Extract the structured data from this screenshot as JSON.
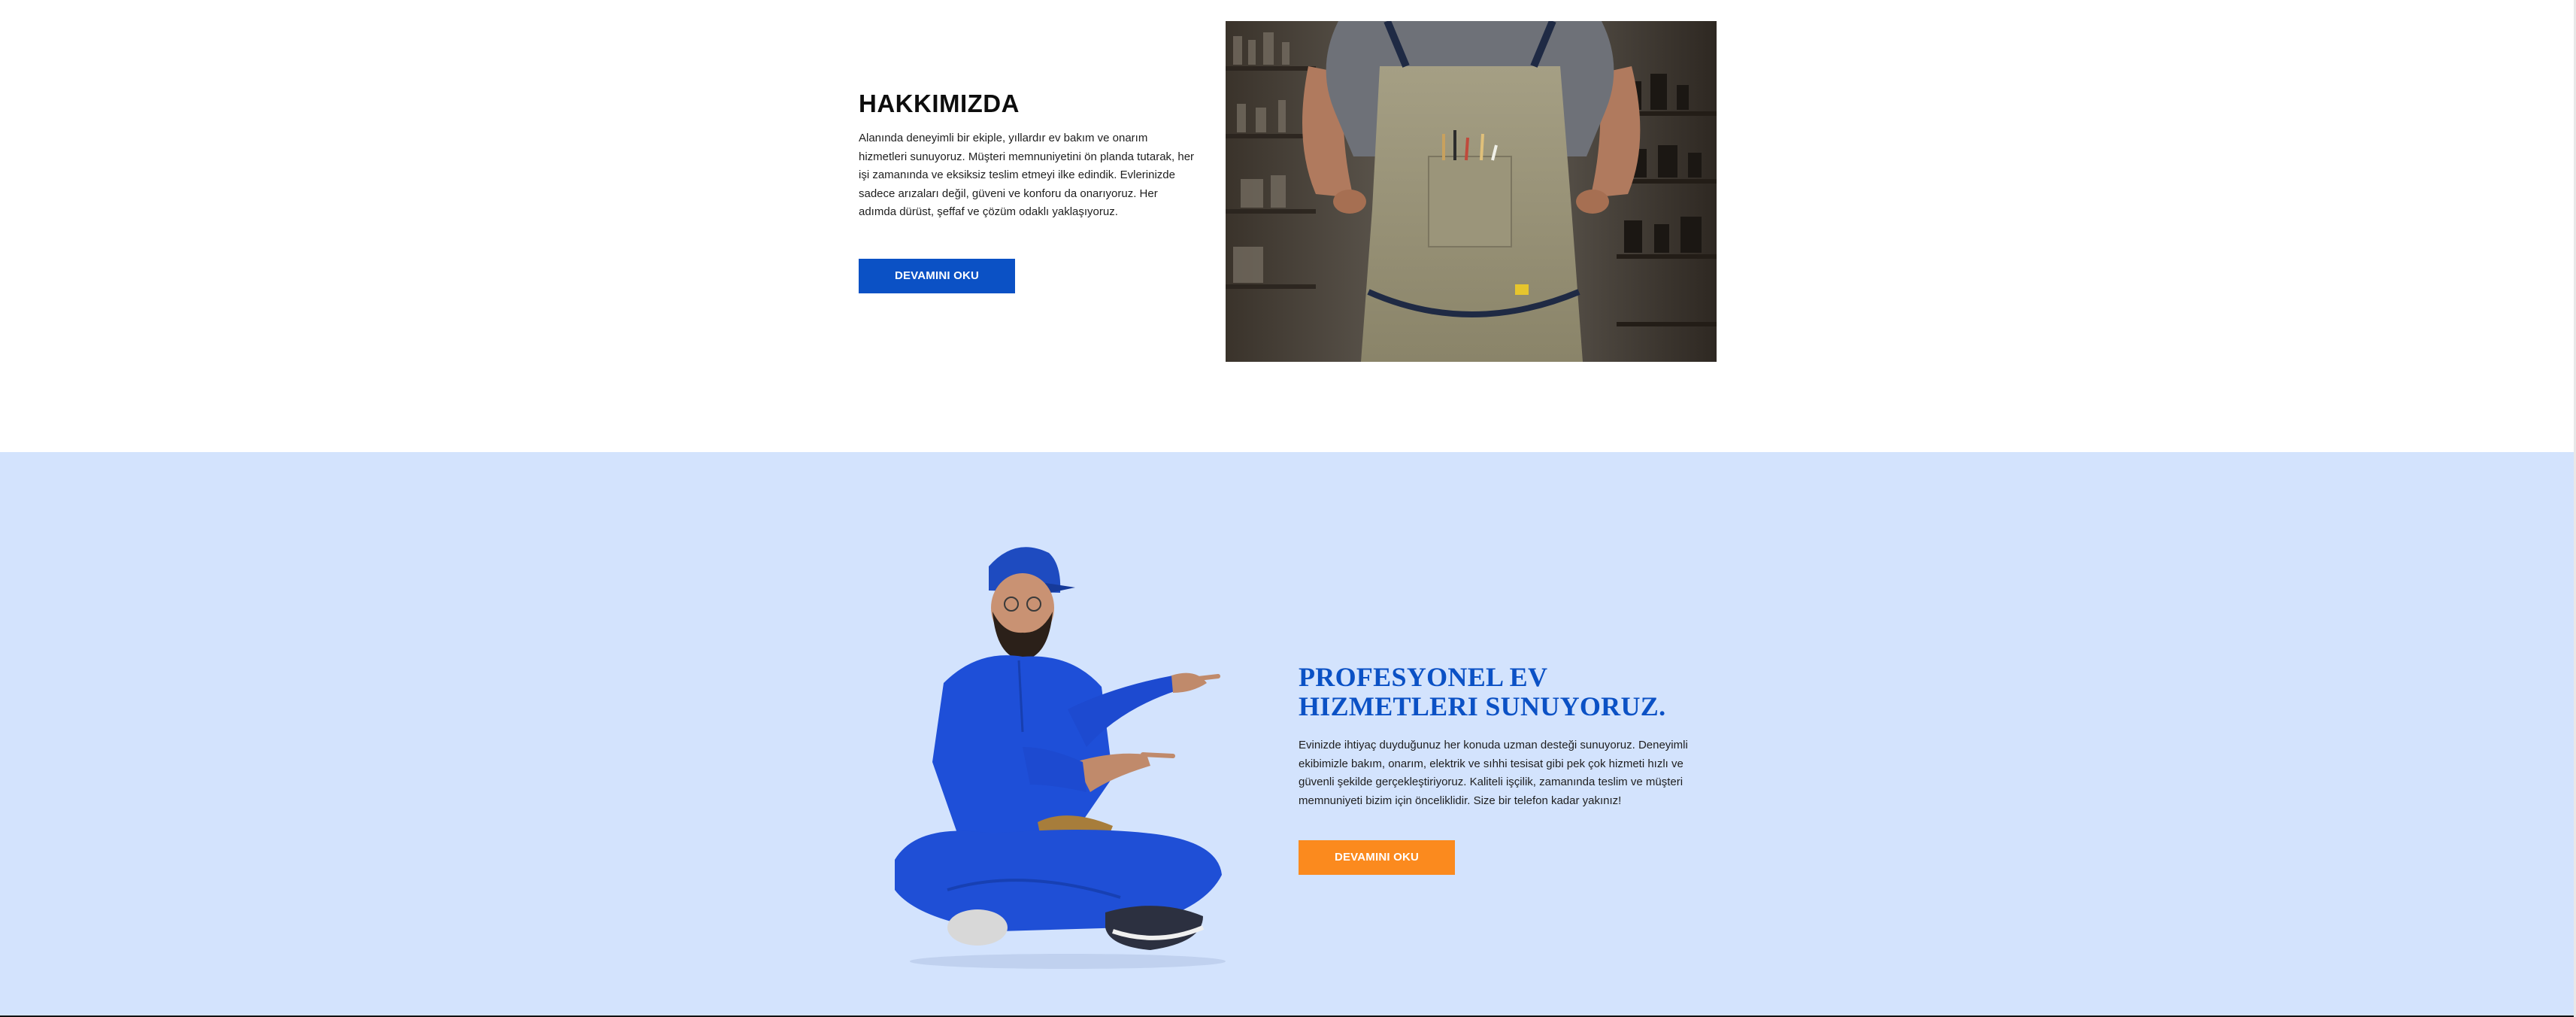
{
  "about": {
    "title": "HAKKIMIZDA",
    "body": "Alanında deneyimli bir ekiple, yıllardır ev bakım ve onarım hizmetleri sunuyoruz. Müşteri memnuniyetini ön planda tutarak, her işi zamanında ve eksiksiz teslim etmeyi ilke edindik. Evlerinizde sadece arızaları değil, güveni ve konforu da onarıyoruz. Her adımda dürüst, şeffaf ve çözüm odaklı yaklaşıyoruz.",
    "button_label": "DEVAMINI OKU",
    "button_color": "#0b51c5"
  },
  "services": {
    "title": "PROFESYONEL EV HIZMETLERI SUNUYORUZ.",
    "body": "Evinizde ihtiyaç duyduğunuz her konuda uzman desteği sunuyoruz. Deneyimli ekibimizle bakım, onarım, elektrik ve sıhhi tesisat gibi pek çok hizmeti hızlı ve güvenli şekilde gerçekleştiriyoruz. Kaliteli işçilik, zamanında teslim ve müşteri memnuniyeti bizim için önceliklidir. Size bir telefon kadar yakınız!",
    "button_label": "DEVAMINI OKU",
    "button_color": "#fb8a1e",
    "background": "#d3e3fd"
  },
  "icons": {
    "about_image": "craftsman-apron-photo",
    "services_image": "handyman-worker-photo"
  }
}
